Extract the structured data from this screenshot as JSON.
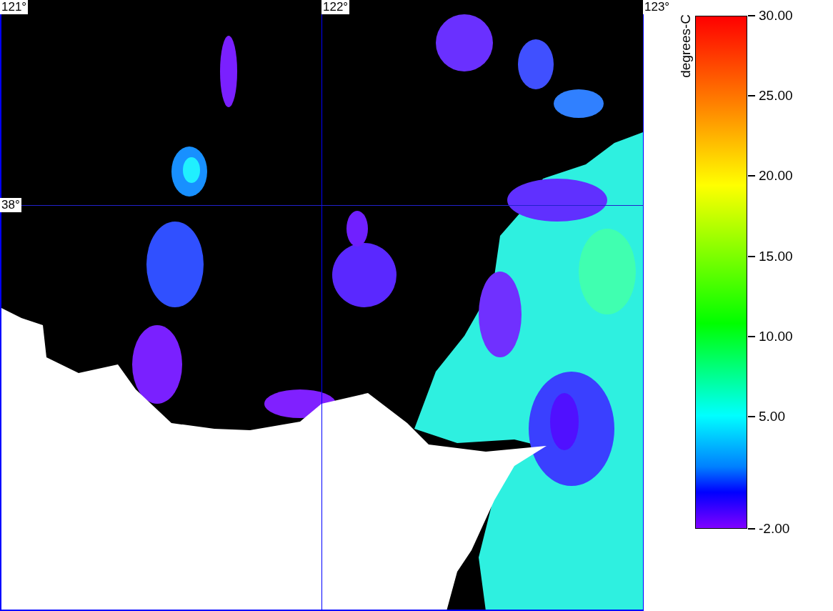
{
  "map": {
    "longitude_labels": [
      "121°",
      "122°",
      "123°"
    ],
    "latitude_labels": [
      "38°"
    ]
  },
  "colorbar": {
    "label": "degrees-C",
    "ticks": [
      "30.00",
      "25.00",
      "20.00",
      "15.00",
      "10.00",
      "5.00",
      "-2.00"
    ]
  }
}
